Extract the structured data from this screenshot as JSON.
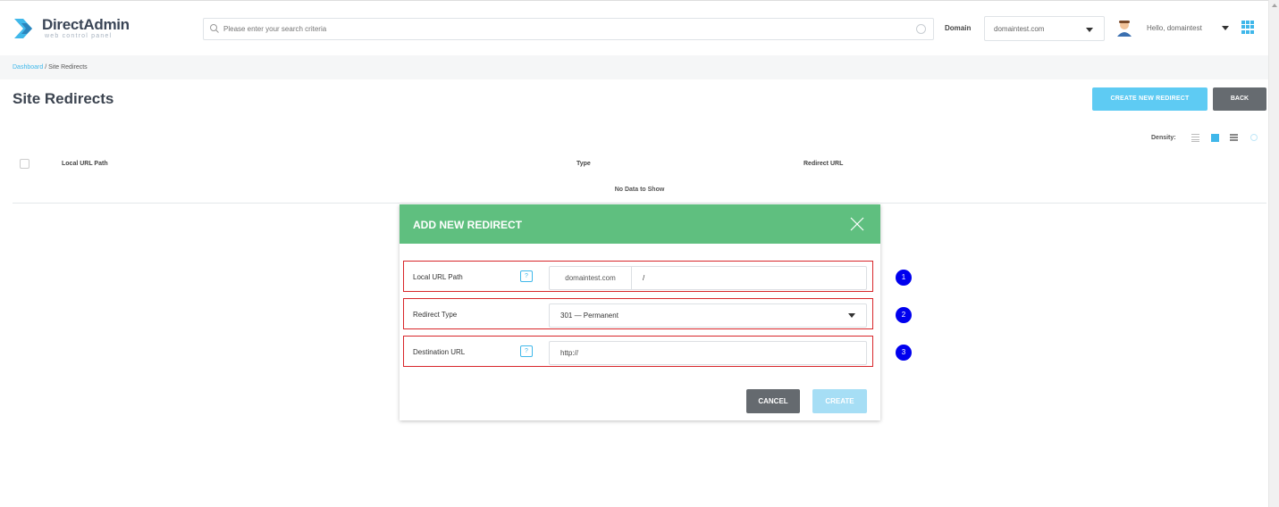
{
  "brand": {
    "name": "DirectAdmin",
    "tagline": "web control panel"
  },
  "header": {
    "search_placeholder": "Please enter your search criteria",
    "domain_label": "Domain",
    "domain_value": "domaintest.com",
    "user_greeting": "Hello,",
    "user_name": "domaintest"
  },
  "breadcrumb": {
    "home": "Dashboard",
    "separator": " / ",
    "current": "Site Redirects"
  },
  "page": {
    "title": "Site Redirects",
    "create_button": "CREATE NEW REDIRECT",
    "back_button": "BACK",
    "density_label": "Density:"
  },
  "table": {
    "columns": [
      "Local URL Path",
      "Type",
      "Redirect URL"
    ],
    "empty_text": "No Data to Show"
  },
  "modal": {
    "title": "ADD NEW REDIRECT",
    "fields": {
      "local_path": {
        "label": "Local URL Path",
        "help": "?",
        "prefix": "domaintest.com",
        "value": "/"
      },
      "redirect_type": {
        "label": "Redirect Type",
        "value": "301 — Permanent"
      },
      "destination": {
        "label": "Destination URL",
        "help": "?",
        "value": "http://"
      }
    },
    "badges": [
      "1",
      "2",
      "3"
    ],
    "cancel_button": "CANCEL",
    "create_button": "CREATE"
  },
  "colors": {
    "accent": "#40b8ea",
    "modal_header": "#5fbf7f",
    "highlight_border": "#d8262a",
    "badge": "#0000ee"
  }
}
